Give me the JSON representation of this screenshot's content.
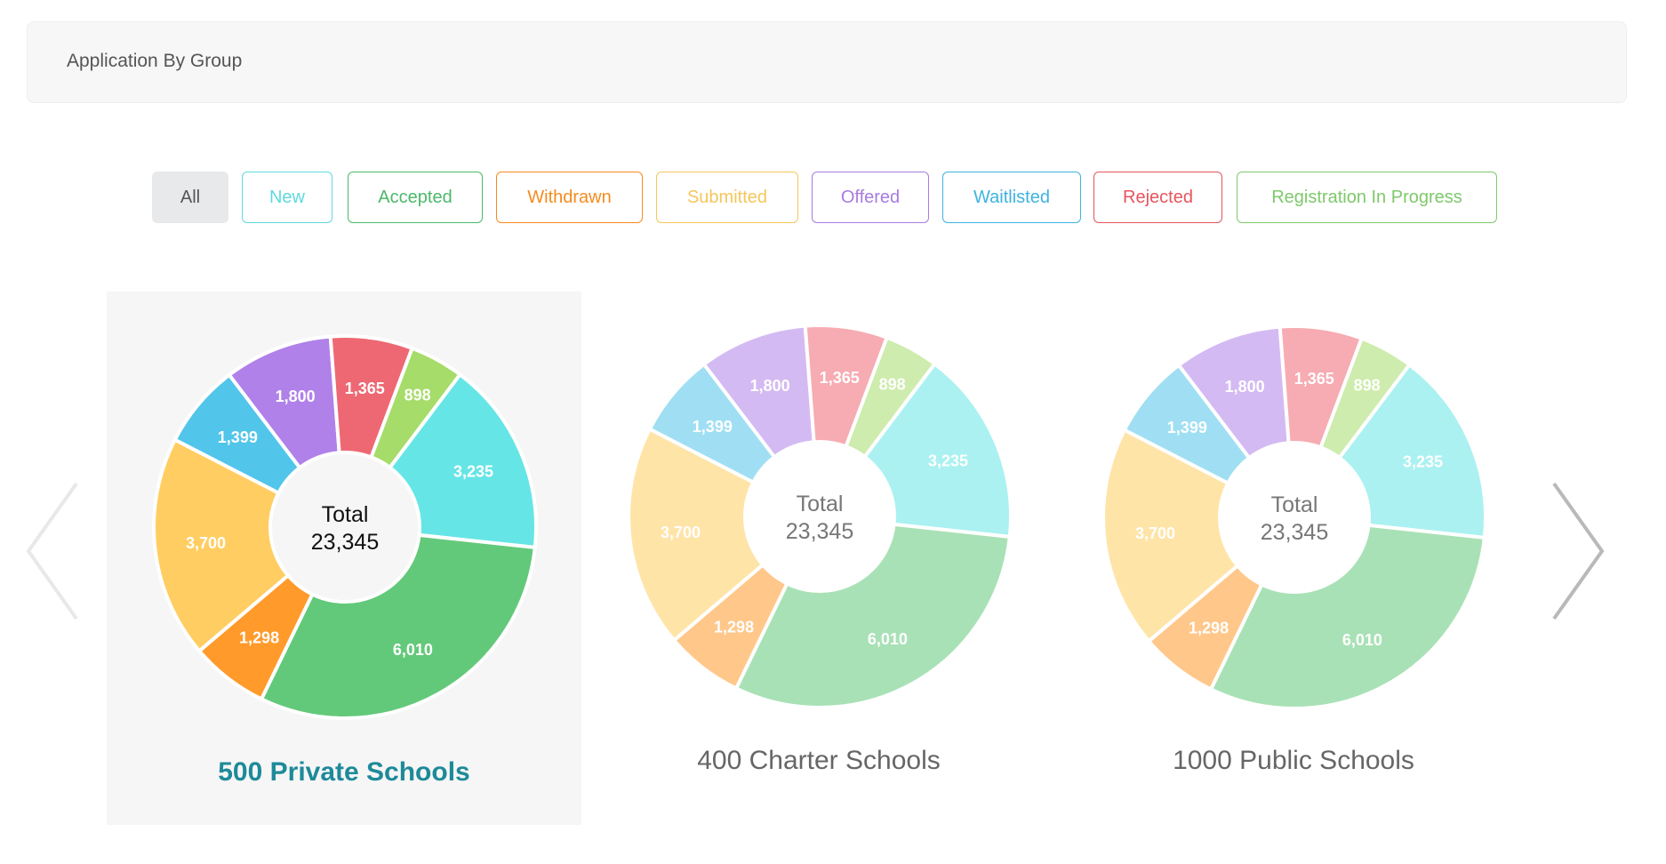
{
  "header": {
    "title": "Application By Group"
  },
  "filters": [
    {
      "label": "All",
      "color": "#555555",
      "active": true
    },
    {
      "label": "New",
      "color": "#5fd9e0"
    },
    {
      "label": "Accepted",
      "color": "#4cb86a"
    },
    {
      "label": "Withdrawn",
      "color": "#f58b1e"
    },
    {
      "label": "Submitted",
      "color": "#f5c65a"
    },
    {
      "label": "Offered",
      "color": "#a77ce0"
    },
    {
      "label": "Waitlisted",
      "color": "#3db3df"
    },
    {
      "label": "Rejected",
      "color": "#e7545e"
    },
    {
      "label": "Registration In Progress",
      "color": "#7ec96b"
    }
  ],
  "status_colors": {
    "New": "#66e5e6",
    "Accepted": "#63c97a",
    "Withdrawn": "#ff9a2b",
    "Submitted": "#ffcd61",
    "Waitlisted": "#52c5ea",
    "Offered": "#b081e8",
    "Rejected": "#ee6873",
    "Registration In Progress": "#a6dc69"
  },
  "center": {
    "label": "Total",
    "value": "23,345"
  },
  "chart_data": [
    {
      "type": "pie",
      "title": "500 Private Schools",
      "selected": true,
      "slices": [
        {
          "label": "New",
          "value": 3235
        },
        {
          "label": "Accepted",
          "value": 6010
        },
        {
          "label": "Withdrawn",
          "value": 1298
        },
        {
          "label": "Submitted",
          "value": 3700
        },
        {
          "label": "Waitlisted",
          "value": 1399
        },
        {
          "label": "Offered",
          "value": 1800
        },
        {
          "label": "Rejected",
          "value": 1365
        },
        {
          "label": "Registration In Progress",
          "value": 898
        }
      ],
      "value_labels": [
        "3,235",
        "6,010",
        "1,298",
        "3,700",
        "1,399",
        "1,800",
        "1,365",
        "898"
      ]
    },
    {
      "type": "pie",
      "title": "400 Charter Schools",
      "selected": false,
      "slices": [
        {
          "label": "New",
          "value": 3235
        },
        {
          "label": "Accepted",
          "value": 6010
        },
        {
          "label": "Withdrawn",
          "value": 1298
        },
        {
          "label": "Submitted",
          "value": 3700
        },
        {
          "label": "Waitlisted",
          "value": 1399
        },
        {
          "label": "Offered",
          "value": 1800
        },
        {
          "label": "Rejected",
          "value": 1365
        },
        {
          "label": "Registration In Progress",
          "value": 898
        }
      ],
      "value_labels": [
        "3,235",
        "6,010",
        "1,298",
        "3,700",
        "1,399",
        "1,800",
        "1,365",
        "898"
      ]
    },
    {
      "type": "pie",
      "title": "1000 Public Schools",
      "selected": false,
      "slices": [
        {
          "label": "New",
          "value": 3235
        },
        {
          "label": "Accepted",
          "value": 6010
        },
        {
          "label": "Withdrawn",
          "value": 1298
        },
        {
          "label": "Submitted",
          "value": 3700
        },
        {
          "label": "Waitlisted",
          "value": 1399
        },
        {
          "label": "Offered",
          "value": 1800
        },
        {
          "label": "Rejected",
          "value": 1365
        },
        {
          "label": "Registration In Progress",
          "value": 898
        }
      ],
      "value_labels": [
        "3,235",
        "6,010",
        "1,298",
        "3,700",
        "1,399",
        "1,800",
        "1,365",
        "898"
      ]
    }
  ],
  "nav": {
    "prev_icon": "chevron-left-icon",
    "next_icon": "chevron-right-icon"
  }
}
